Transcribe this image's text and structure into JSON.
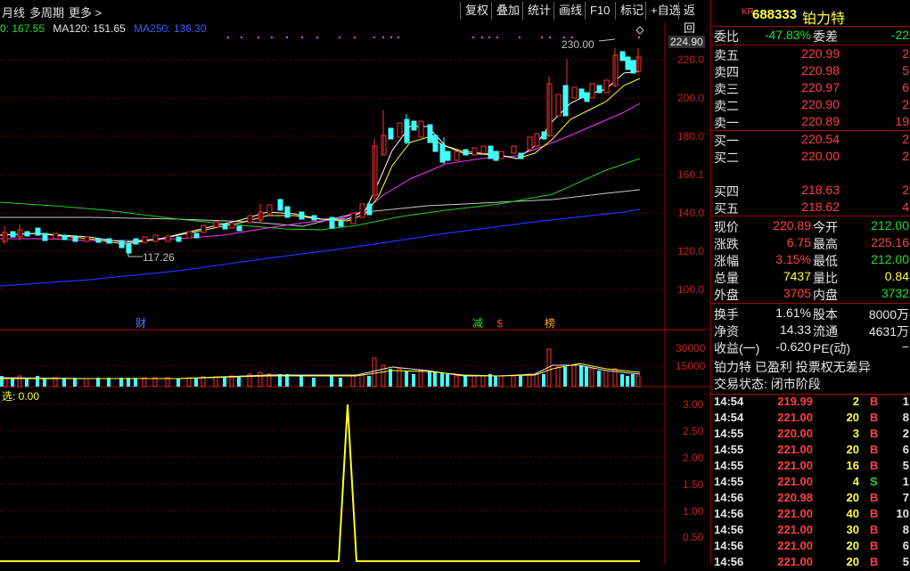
{
  "toolbar": {
    "period_label": "月线",
    "multi_period": "多周期",
    "more": "更多 >",
    "buttons": [
      "复权",
      "叠加",
      "统计",
      "画线",
      "F10",
      "标记",
      "+自选",
      "返回"
    ]
  },
  "ma_line": {
    "ma_a": "0: 167.55",
    "ma120": "MA120: 151.65",
    "ma250": "MA250: 136.30"
  },
  "price_chart": {
    "current_price_tag": "224.90",
    "high_marker": "230.00",
    "low_marker": "117.26",
    "y_ticks": [
      "220.0",
      "200.0",
      "180.0",
      "160.1",
      "140.0",
      "120.0",
      "100.0"
    ],
    "event_marks": [
      {
        "label": "财",
        "color": "#3a7bff"
      },
      {
        "label": "减",
        "color": "#20e020"
      },
      {
        "label": "$",
        "color": "#ff3030"
      },
      {
        "label": "榜",
        "color": "#ffa020"
      }
    ]
  },
  "volume_chart": {
    "y_ticks": [
      "30000",
      "15000"
    ]
  },
  "indicator": {
    "label": "选: 0.00",
    "y_ticks": [
      "3.00",
      "2.50",
      "2.00",
      "1.50",
      "1.00",
      "0.50"
    ]
  },
  "stock": {
    "code": "688333",
    "market_tag": "KR",
    "name": "铂力特"
  },
  "order_book": {
    "weibi_label": "委比",
    "weibi_value": "-47.83%",
    "weicha_label": "委差",
    "weicha_value": "-22",
    "asks": [
      {
        "label": "卖五",
        "price": "220.99",
        "vol": "2"
      },
      {
        "label": "卖四",
        "price": "220.98",
        "vol": "5"
      },
      {
        "label": "卖三",
        "price": "220.97",
        "vol": "6"
      },
      {
        "label": "卖二",
        "price": "220.90",
        "vol": "2"
      },
      {
        "label": "卖一",
        "price": "220.89",
        "vol": "19"
      }
    ],
    "bids": [
      {
        "label": "买一",
        "price": "220.54",
        "vol": "2"
      },
      {
        "label": "买二",
        "price": "220.00",
        "vol": "2"
      },
      {
        "label": "买四",
        "price": "218.63",
        "vol": "2"
      },
      {
        "label": "买五",
        "price": "218.62",
        "vol": "4"
      }
    ]
  },
  "quote": {
    "xianjia_l": "现价",
    "xianjia": "220.89",
    "jinkai_l": "今开",
    "jinkai": "212.00",
    "zhangdie_l": "涨跌",
    "zhangdie": "6.75",
    "zuigao_l": "最高",
    "zuigao": "225.16",
    "zhangfu_l": "涨幅",
    "zhangfu": "3.15%",
    "zuidi_l": "最低",
    "zuidi": "212.00",
    "zongliang_l": "总量",
    "zongliang": "7437",
    "liangbi_l": "量比",
    "liangbi": "0.84",
    "waipan_l": "外盘",
    "waipan": "3705",
    "neipan_l": "内盘",
    "neipan": "3732"
  },
  "fundamentals": {
    "huanshou_l": "换手",
    "huanshou": "1.61%",
    "guben_l": "股本",
    "guben": "8000万",
    "jingzi_l": "净资",
    "jingzi": "14.33",
    "liutong_l": "流通",
    "liutong": "4631万",
    "shouyi_l": "收益(一)",
    "shouyi": "-0.620",
    "pe_l": "PE(动)",
    "pe": "−",
    "tag_line": "铂力特 已盈利 投票权无差异",
    "status_line": "交易状态: 闭市阶段"
  },
  "ticks": [
    {
      "time": "14:54",
      "price": "219.99",
      "vol": "2",
      "side": "B",
      "n": "1"
    },
    {
      "time": "14:54",
      "price": "221.00",
      "vol": "20",
      "side": "B",
      "n": "8"
    },
    {
      "time": "14:55",
      "price": "220.00",
      "vol": "3",
      "side": "B",
      "n": "2"
    },
    {
      "time": "14:55",
      "price": "221.00",
      "vol": "20",
      "side": "B",
      "n": "6"
    },
    {
      "time": "14:55",
      "price": "221.00",
      "vol": "16",
      "side": "B",
      "n": "5"
    },
    {
      "time": "14:55",
      "price": "221.00",
      "vol": "4",
      "side": "S",
      "n": "1"
    },
    {
      "time": "14:56",
      "price": "220.98",
      "vol": "20",
      "side": "B",
      "n": "7"
    },
    {
      "time": "14:56",
      "price": "221.00",
      "vol": "40",
      "side": "B",
      "n": "10"
    },
    {
      "time": "14:56",
      "price": "221.00",
      "vol": "30",
      "side": "B",
      "n": "8"
    },
    {
      "time": "14:56",
      "price": "221.00",
      "vol": "20",
      "side": "B",
      "n": "6"
    },
    {
      "time": "14:56",
      "price": "221.00",
      "vol": "20",
      "side": "B",
      "n": "5"
    }
  ]
}
